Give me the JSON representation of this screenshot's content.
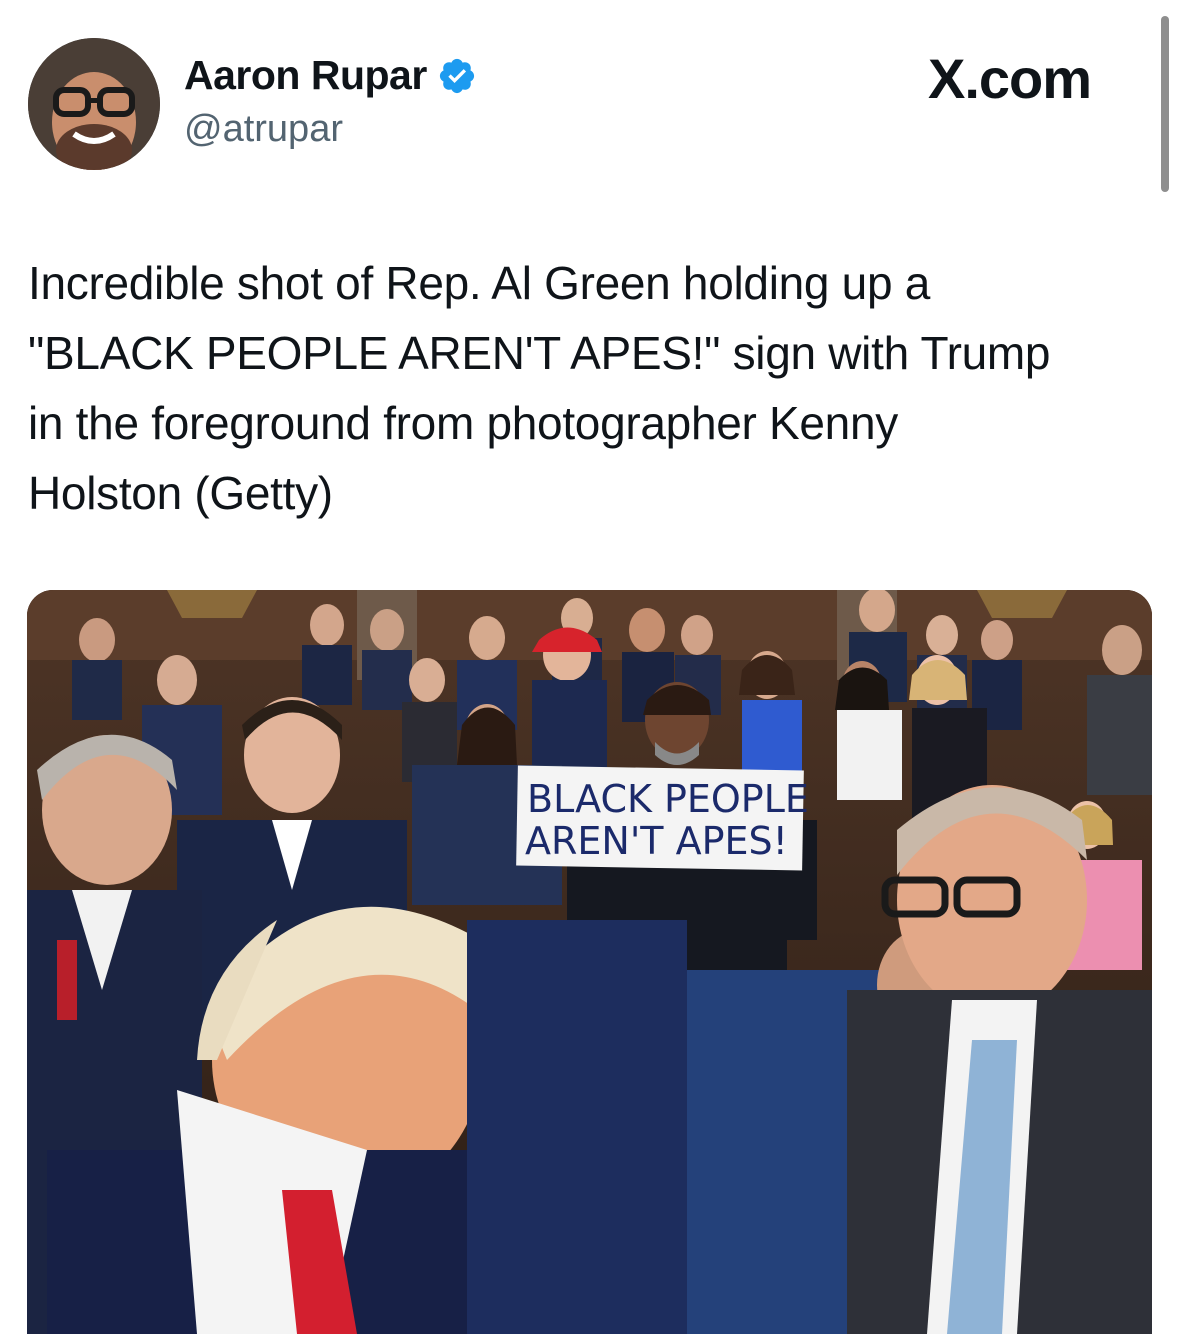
{
  "author": {
    "name": "Aaron Rupar",
    "handle": "@atrupar",
    "verified": true,
    "avatar_icon": "profile-photo"
  },
  "brand": "X.com",
  "tweet": {
    "lines": [
      "Incredible shot of Rep. Al Green holding up a",
      "\"BLACK PEOPLE AREN'T APES!\" sign with Trump",
      "in the foreground from photographer Kenny",
      "Holston (Getty)"
    ]
  },
  "media": {
    "sign_lines": [
      "BLACK PEOPLE",
      "AREN'T APES!"
    ]
  },
  "colors": {
    "verified_blue": "#1d9bf0",
    "secondary_text": "#536471"
  }
}
